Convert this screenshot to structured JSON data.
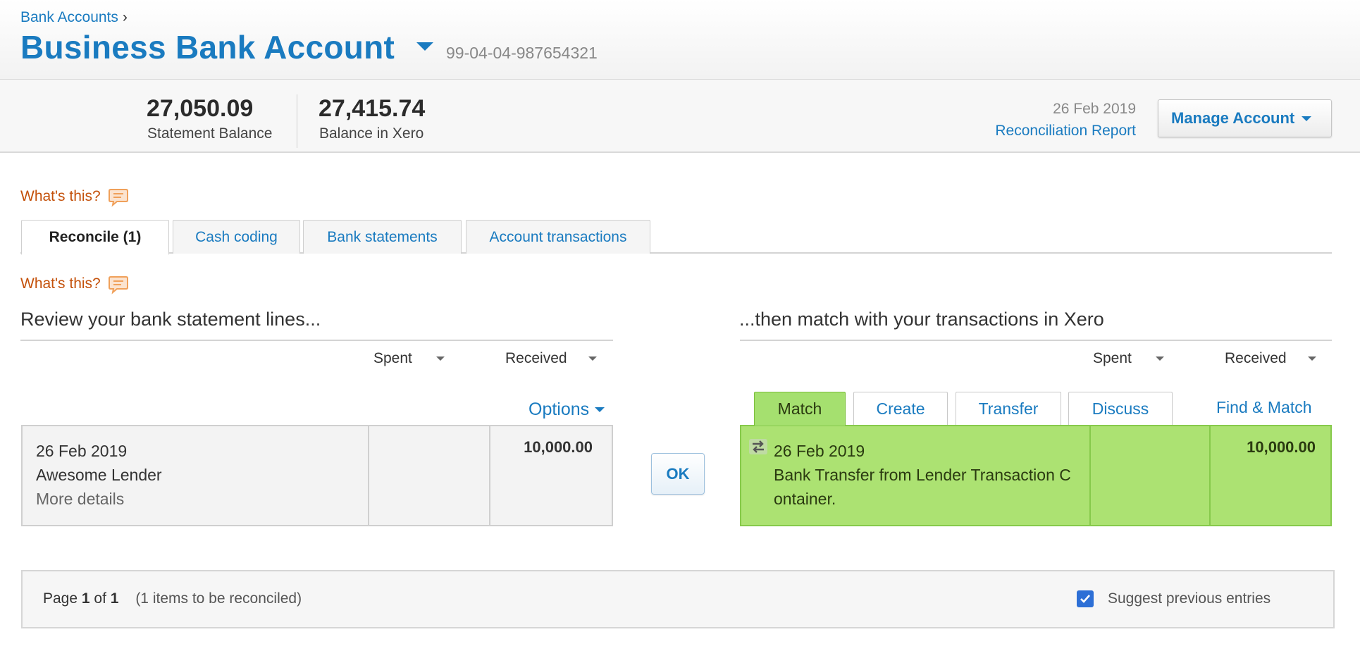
{
  "header": {
    "breadcrumb": "Bank Accounts",
    "breadcrumb_sep": "›",
    "title": "Business Bank Account",
    "account_number": "99-04-04-987654321"
  },
  "balances": {
    "statement_amount": "27,050.09",
    "statement_label": "Statement Balance",
    "xero_amount": "27,415.74",
    "xero_label": "Balance in Xero",
    "statement_date": "26 Feb 2019",
    "reconciliation_report": "Reconciliation Report",
    "manage_account": "Manage Account"
  },
  "help": {
    "whats_this": "What's this?"
  },
  "tabs": [
    {
      "label": "Reconcile (1)",
      "active": true
    },
    {
      "label": "Cash coding"
    },
    {
      "label": "Bank statements"
    },
    {
      "label": "Account transactions"
    }
  ],
  "left_column": {
    "heading": "Review your bank statement lines...",
    "spent": "Spent",
    "received": "Received",
    "options": "Options",
    "line": {
      "date": "26 Feb 2019",
      "payee": "Awesome Lender",
      "more_details": "More details",
      "spent": "",
      "received": "10,000.00"
    }
  },
  "ok_button": "OK",
  "right_column": {
    "heading": "...then match with your transactions in Xero",
    "spent": "Spent",
    "received": "Received",
    "tabs": [
      "Match",
      "Create",
      "Transfer",
      "Discuss"
    ],
    "find_match": "Find & Match",
    "match": {
      "date": "26 Feb 2019",
      "description_line1": "Bank Transfer from Lender Transaction C",
      "description_line2": "ontainer.",
      "spent": "",
      "received": "10,000.00"
    }
  },
  "pager": {
    "page_label": "Page",
    "page": "1",
    "of_label": "of",
    "total": "1",
    "items_note": "(1 items to be reconciled)",
    "suggest_label": "Suggest previous entries",
    "suggest_checked": true
  },
  "colors": {
    "link": "#1a7bc0",
    "whats_this": "#c4510b",
    "match_green": "#ace272"
  }
}
